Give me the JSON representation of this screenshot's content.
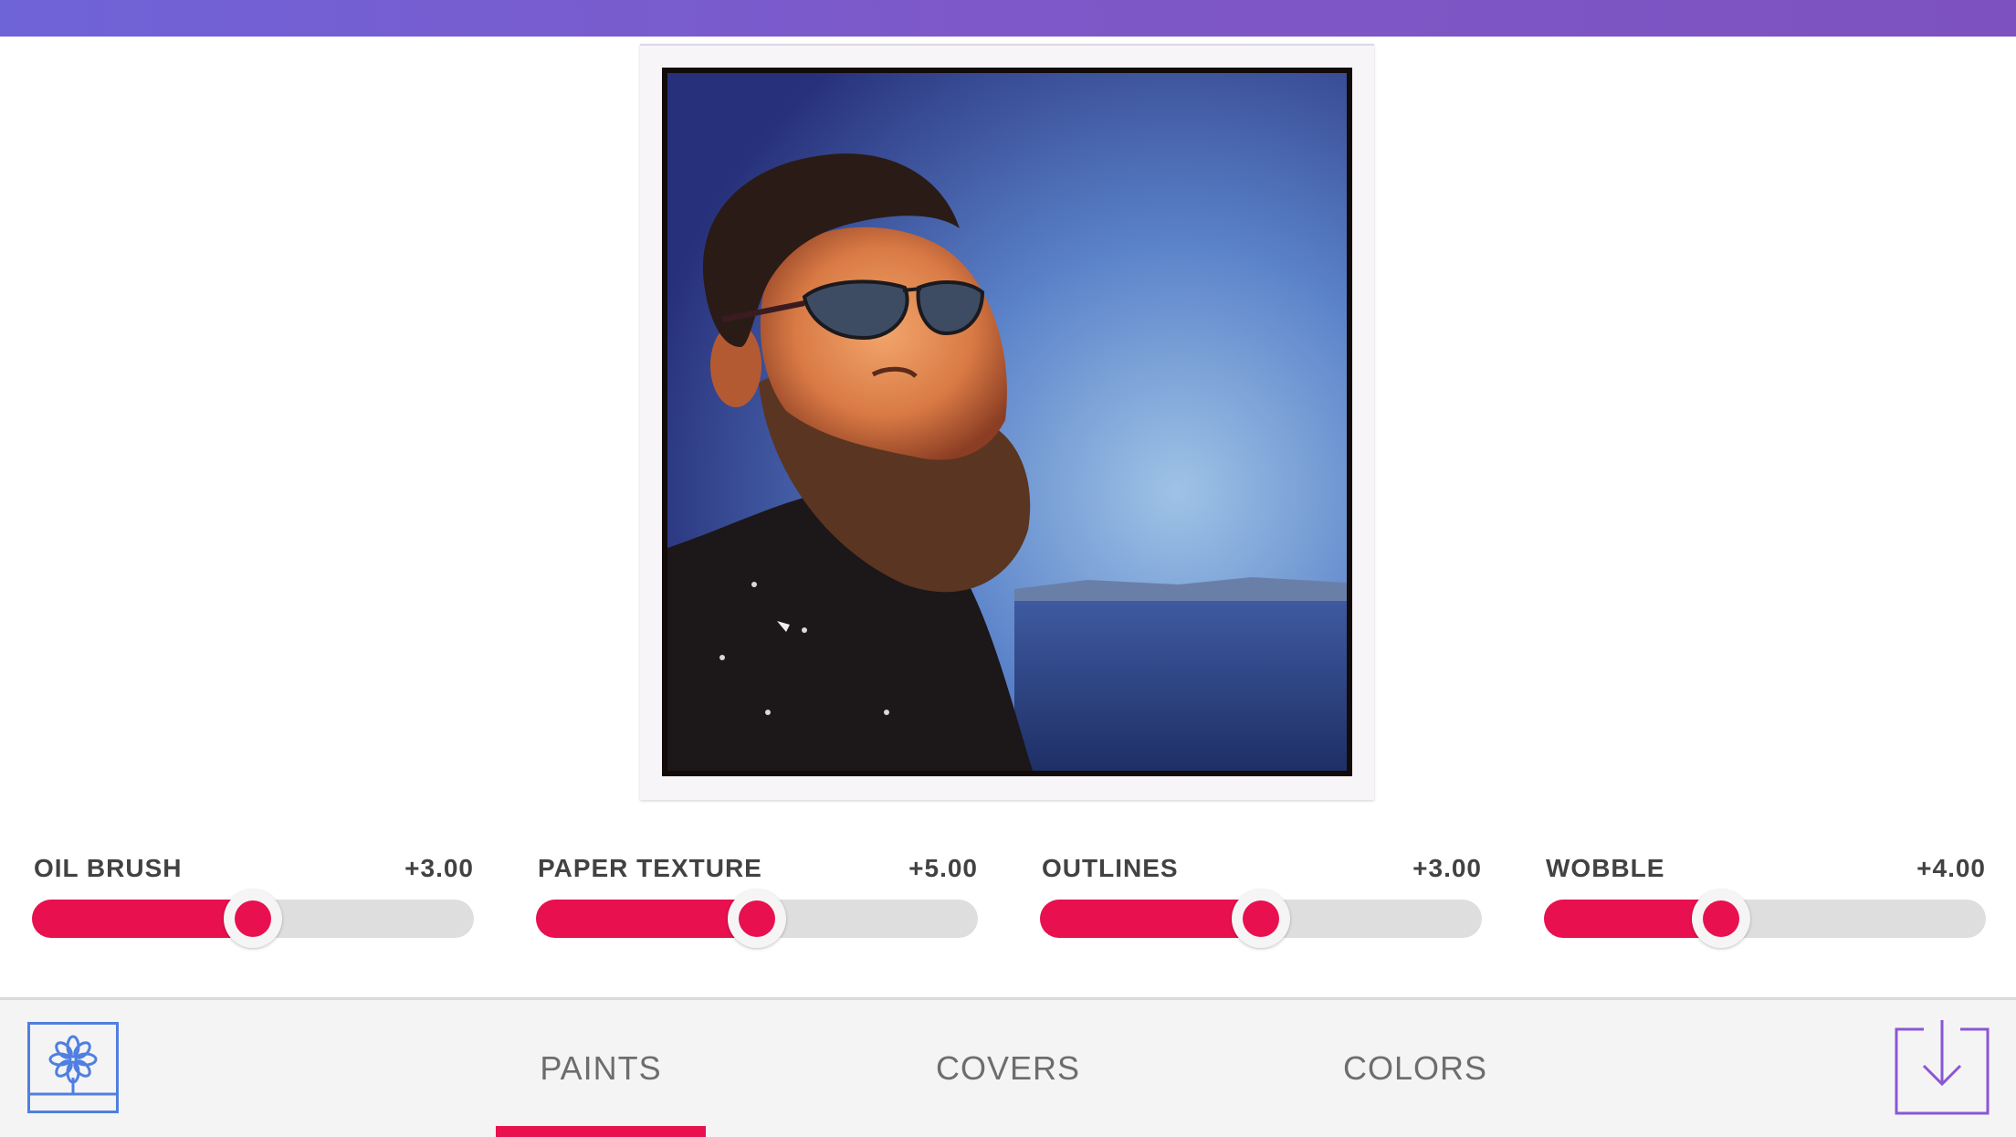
{
  "colors": {
    "accent": "#e8104f",
    "header_gradient_start": "#6f63d8",
    "header_gradient_end": "#7d52c0",
    "track": "#dedede",
    "logo_blue": "#4f7fe0",
    "download_purple": "#8a56d6"
  },
  "photo": {
    "description_icon": "watercolor-portrait-photo"
  },
  "sliders": [
    {
      "label": "OIL BRUSH",
      "value_text": "+3.00",
      "level": 0.5
    },
    {
      "label": "PAPER TEXTURE",
      "value_text": "+5.00",
      "level": 0.5
    },
    {
      "label": "OUTLINES",
      "value_text": "+3.00",
      "level": 0.5
    },
    {
      "label": "WOBBLE",
      "value_text": "+4.00",
      "level": 0.4
    }
  ],
  "tabs": [
    {
      "label": "PAINTS",
      "active": true
    },
    {
      "label": "COVERS",
      "active": false
    },
    {
      "label": "COLORS",
      "active": false
    }
  ],
  "icons": {
    "logo": "flower-logo-icon",
    "download": "download-icon"
  }
}
